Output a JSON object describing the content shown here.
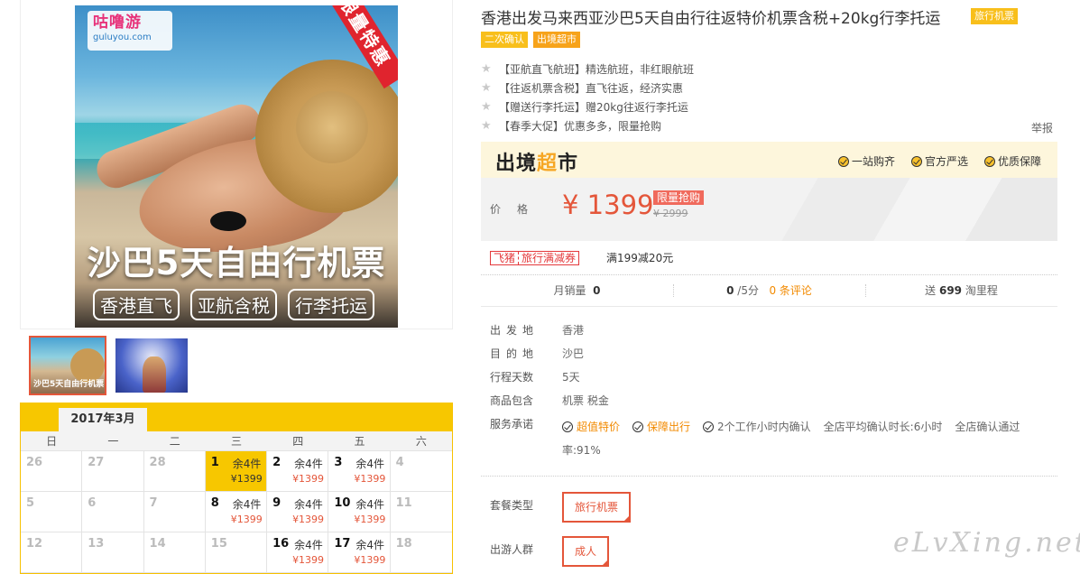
{
  "hero": {
    "logo_text": "咕噜游",
    "logo_domain": "guluyou.com",
    "ribbon": "限量特惠",
    "title": "沙巴5天自由行机票",
    "tags": [
      "香港直飞",
      "亚航含税",
      "行李托运"
    ]
  },
  "thumbs": {
    "thumb1_caption": "沙巴5天自由行机票"
  },
  "calendar": {
    "month": "2017年3月",
    "weekdays": [
      "日",
      "一",
      "二",
      "三",
      "四",
      "五",
      "六"
    ],
    "days": [
      {
        "d": "26",
        "stock": "",
        "price": ""
      },
      {
        "d": "27",
        "stock": "",
        "price": ""
      },
      {
        "d": "28",
        "stock": "",
        "price": ""
      },
      {
        "d": "1",
        "stock": "余4件",
        "price": "¥1399",
        "selected": true
      },
      {
        "d": "2",
        "stock": "余4件",
        "price": "¥1399"
      },
      {
        "d": "3",
        "stock": "余4件",
        "price": "¥1399"
      },
      {
        "d": "4",
        "stock": "",
        "price": ""
      },
      {
        "d": "5",
        "stock": "",
        "price": ""
      },
      {
        "d": "6",
        "stock": "",
        "price": ""
      },
      {
        "d": "7",
        "stock": "",
        "price": ""
      },
      {
        "d": "8",
        "stock": "余4件",
        "price": "¥1399"
      },
      {
        "d": "9",
        "stock": "余4件",
        "price": "¥1399"
      },
      {
        "d": "10",
        "stock": "余4件",
        "price": "¥1399"
      },
      {
        "d": "11",
        "stock": "",
        "price": ""
      },
      {
        "d": "12",
        "stock": "",
        "price": ""
      },
      {
        "d": "13",
        "stock": "",
        "price": ""
      },
      {
        "d": "14",
        "stock": "",
        "price": ""
      },
      {
        "d": "15",
        "stock": "",
        "price": ""
      },
      {
        "d": "16",
        "stock": "余4件",
        "price": "¥1399"
      },
      {
        "d": "17",
        "stock": "余4件",
        "price": "¥1399"
      },
      {
        "d": "18",
        "stock": "",
        "price": ""
      }
    ]
  },
  "product": {
    "title": "香港出发马来西亚沙巴5天自由行往返特价机票含税+20kg行李托运",
    "title_badge": "旅行机票",
    "badges": [
      "二次确认",
      "出境超市"
    ],
    "features": [
      "【亚航直飞航班】精选航班，非红眼航班",
      "【往返机票含税】直飞往返，经济实惠",
      "【赠送行李托运】赠20kg往返行李托运",
      "【春季大促】优惠多多，限量抢购"
    ],
    "report": "举报"
  },
  "market": {
    "logo_a": "出境",
    "logo_b": "超",
    "logo_c": "市",
    "assures": [
      "一站购齐",
      "官方严选",
      "优质保障"
    ]
  },
  "price": {
    "label": "价格",
    "current": "¥ 1399",
    "tag": "限量抢购",
    "original": "¥ 2999"
  },
  "coupon": {
    "brand": "飞猪",
    "name": "旅行满减券",
    "desc": "满199减20元"
  },
  "stats": {
    "sales_label": "月销量",
    "sales": "0",
    "score": "0",
    "score_unit": "/5分",
    "reviews": "0 条评论",
    "miles_prefix": "送",
    "miles": "699",
    "miles_unit": "淘里程"
  },
  "info": {
    "rows": [
      {
        "k": "出发地",
        "v": "香港"
      },
      {
        "k": "目的地",
        "v": "沙巴"
      },
      {
        "k": "行程天数",
        "v": "5天"
      },
      {
        "k": "商品包含",
        "v": "机票  税金"
      }
    ],
    "service_label": "服务承诺",
    "services": [
      "超值特价",
      "保障出行",
      "2个工作小时内确认",
      "全店平均确认时长:6小时",
      "全店确认通过"
    ],
    "service_line2": "率:91%"
  },
  "options": {
    "package_label": "套餐类型",
    "package_value": "旅行机票",
    "people_label": "出游人群",
    "people_value": "成人"
  },
  "watermark": "eLvXing.net",
  "colors": {
    "accent": "#e4563a",
    "yellow": "#f7c700",
    "orange": "#f28a00"
  }
}
